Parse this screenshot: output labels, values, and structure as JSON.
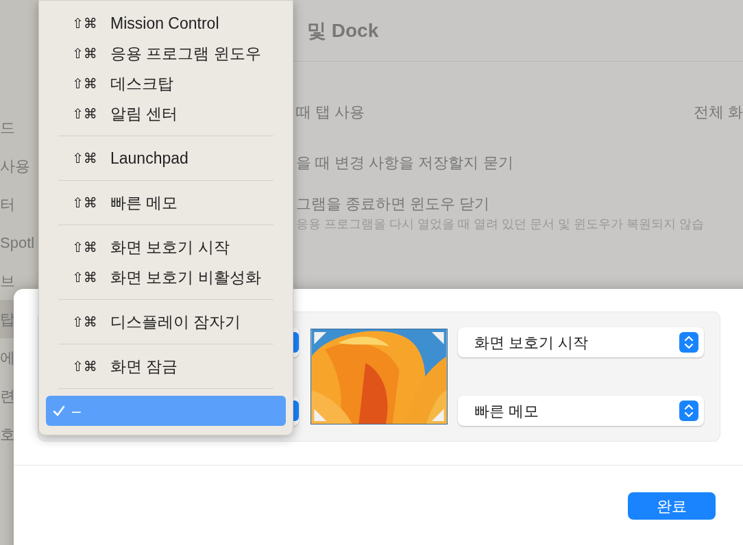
{
  "sidebar": {
    "items": [
      {
        "label": "드",
        "selected": false
      },
      {
        "label": "사용",
        "selected": false
      },
      {
        "label": "터",
        "selected": false
      },
      {
        "label": "Spotl",
        "selected": false
      },
      {
        "label": "브",
        "selected": false
      },
      {
        "label": "탑",
        "selected": true
      },
      {
        "label": "에",
        "selected": false
      },
      {
        "label": "련",
        "selected": false
      },
      {
        "label": "호",
        "selected": false
      }
    ]
  },
  "window": {
    "title": "및 Dock"
  },
  "settings": [
    {
      "label": "때 탭 사용",
      "value": "전체 화"
    },
    {
      "label": "을 때 변경 사항을 저장할지 묻기"
    },
    {
      "label": "그램을 종료하면 윈도우 닫기",
      "description": "응용 프로그램을 다시 열었을 때 열려 있던 문서 및 윈도우가 복원되지 않습"
    }
  ],
  "hot_corners": {
    "top_right": "화면 보호기 시작",
    "bottom_right": "빠른 메모"
  },
  "done_button": "완료",
  "menu": {
    "groups": [
      {
        "items": [
          {
            "keys": "⇧⌘",
            "label": "Mission Control",
            "selected": false
          },
          {
            "keys": "⇧⌘",
            "label": "응용 프로그램 윈도우",
            "selected": false
          },
          {
            "keys": "⇧⌘",
            "label": "데스크탑",
            "selected": false
          },
          {
            "keys": "⇧⌘",
            "label": "알림 센터",
            "selected": false
          }
        ]
      },
      {
        "items": [
          {
            "keys": "⇧⌘",
            "label": "Launchpad",
            "selected": false
          }
        ]
      },
      {
        "items": [
          {
            "keys": "⇧⌘",
            "label": "빠른 메모",
            "selected": false
          }
        ]
      },
      {
        "items": [
          {
            "keys": "⇧⌘",
            "label": "화면 보호기 시작",
            "selected": false
          },
          {
            "keys": "⇧⌘",
            "label": "화면 보호기 비활성화",
            "selected": false
          }
        ]
      },
      {
        "items": [
          {
            "keys": "⇧⌘",
            "label": "디스플레이 잠자기",
            "selected": false
          }
        ]
      },
      {
        "items": [
          {
            "keys": "⇧⌘",
            "label": "화면 잠금",
            "selected": false
          }
        ]
      },
      {
        "items": [
          {
            "label": "–",
            "selected": true
          }
        ]
      }
    ]
  }
}
